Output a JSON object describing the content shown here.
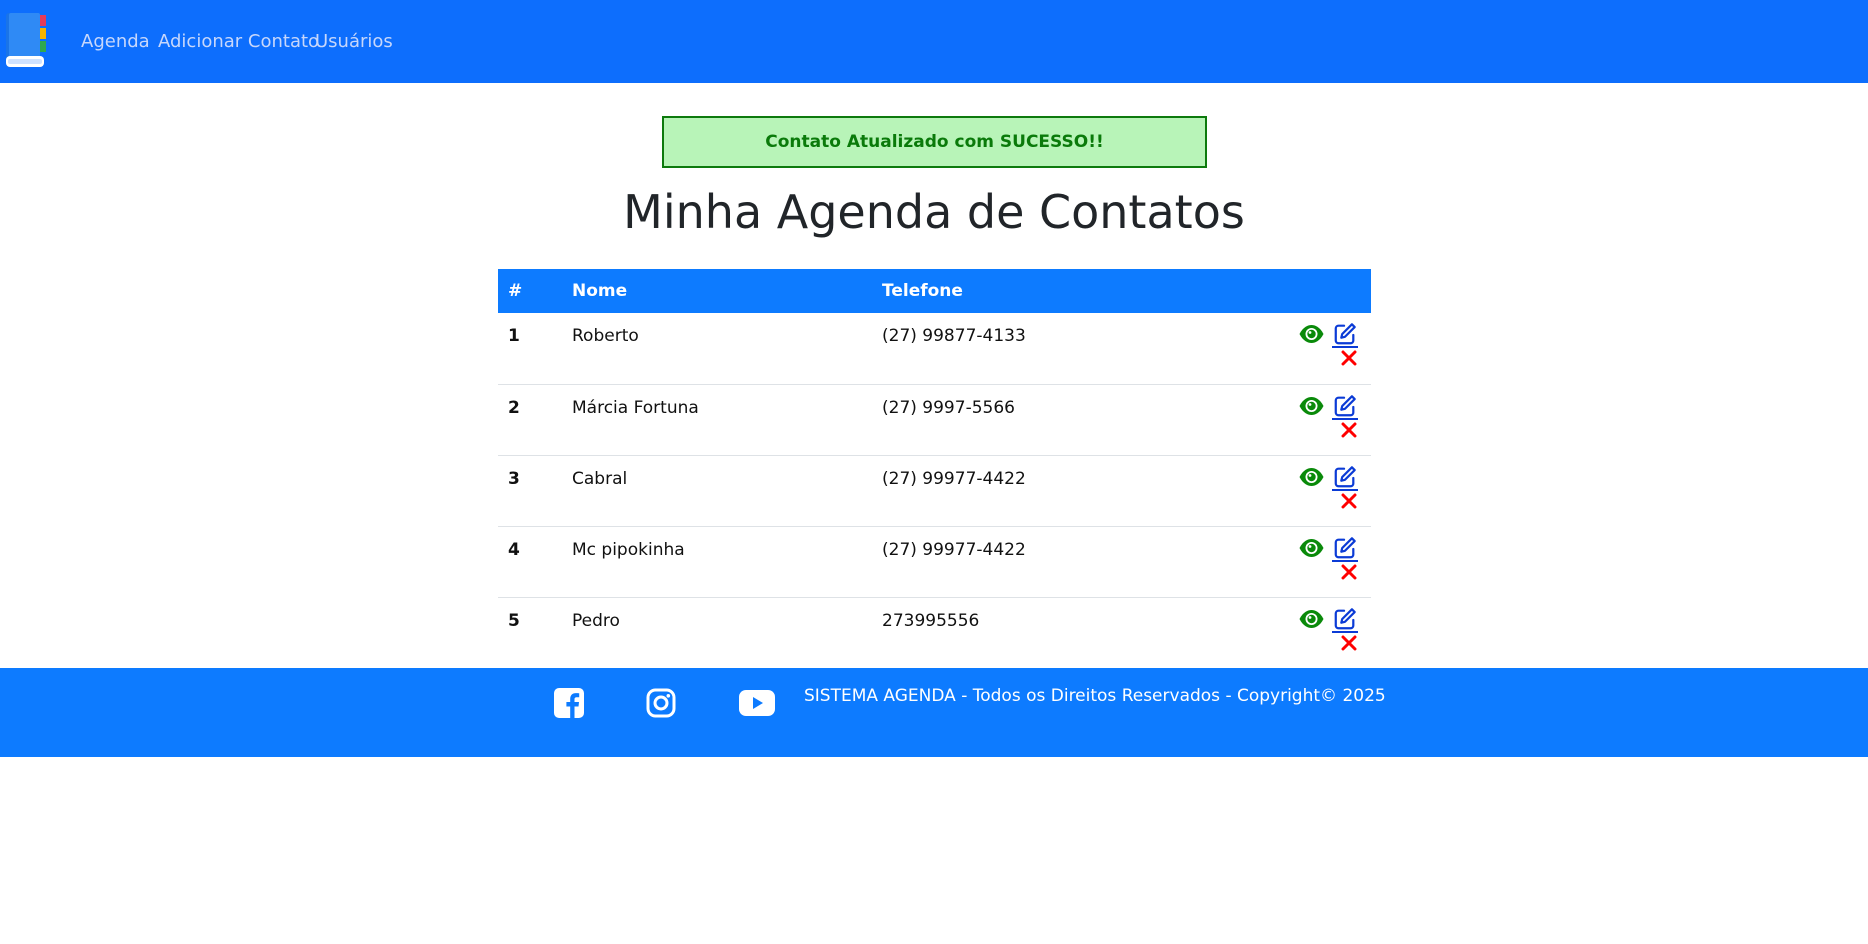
{
  "nav": {
    "links": [
      "Agenda",
      "Adicionar Contato",
      "Usuários"
    ]
  },
  "alert": {
    "message": "Contato Atualizado com SUCESSO!!"
  },
  "page_title": "Minha Agenda de Contatos",
  "table": {
    "headers": [
      "#",
      "Nome",
      "Telefone"
    ],
    "rows": [
      {
        "id": "1",
        "nome": "Roberto",
        "telefone": "(27) 99877-4133"
      },
      {
        "id": "2",
        "nome": "Márcia Fortuna",
        "telefone": "(27) 9997-5566"
      },
      {
        "id": "3",
        "nome": "Cabral",
        "telefone": "(27) 99977-4422"
      },
      {
        "id": "4",
        "nome": "Mc pipokinha",
        "telefone": "(27) 99977-4422"
      },
      {
        "id": "5",
        "nome": "Pedro",
        "telefone": "273995556"
      }
    ],
    "row_actions": [
      "eye-icon",
      "edit-icon",
      "close-icon"
    ]
  },
  "footer": {
    "social_icons": [
      "facebook-icon",
      "instagram-icon",
      "youtube-icon"
    ],
    "copyright": "SISTEMA AGENDA - Todos os Direitos Reservados - Copyright© 2025"
  },
  "colors": {
    "navbar": "#0d6efd",
    "table_header": "#0d7bff",
    "alert_bg": "#b8f4b8",
    "alert_text": "#0a7a0a",
    "view_icon": "#0a8a0a",
    "edit_icon": "#0b3bd6",
    "delete_icon": "#ff0000"
  }
}
